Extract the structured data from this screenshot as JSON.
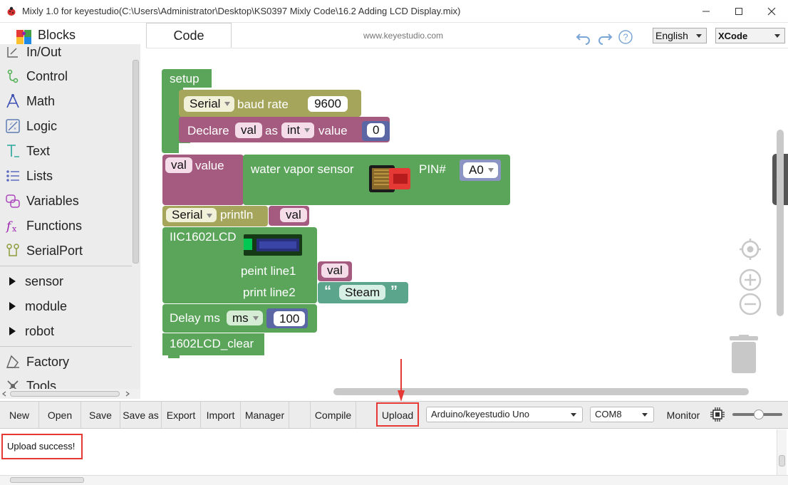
{
  "window": {
    "title": "Mixly 1.0 for keyestudio(C:\\Users\\Administrator\\Desktop\\KS0397 Mixly Code\\16.2 Adding LCD Display.mix)",
    "min_icon": "minimize-icon",
    "max_icon": "maximize-icon",
    "close_icon": "close-icon"
  },
  "tabs": {
    "blocks": "Blocks",
    "code": "Code"
  },
  "header": {
    "site": "www.keyestudio.com",
    "language": "English",
    "code_mode": "XCode"
  },
  "toolbox": {
    "items": [
      {
        "label": "In/Out",
        "icon": "in-out-icon"
      },
      {
        "label": "Control",
        "icon": "control-icon"
      },
      {
        "label": "Math",
        "icon": "math-icon"
      },
      {
        "label": "Logic",
        "icon": "logic-icon"
      },
      {
        "label": "Text",
        "icon": "text-icon"
      },
      {
        "label": "Lists",
        "icon": "lists-icon"
      },
      {
        "label": "Variables",
        "icon": "variables-icon"
      },
      {
        "label": "Functions",
        "icon": "functions-icon"
      },
      {
        "label": "SerialPort",
        "icon": "serialport-icon"
      }
    ],
    "groups": [
      "sensor",
      "module",
      "robot"
    ],
    "extra": [
      {
        "label": "Factory",
        "icon": "factory-icon"
      },
      {
        "label": "Tools",
        "icon": "tools-icon"
      }
    ]
  },
  "blocks": {
    "setup": "setup",
    "serial": "Serial",
    "baud_rate": "baud rate",
    "baud_value": "9600",
    "declare": "Declare",
    "var_name": "val",
    "as": "as",
    "type": "int",
    "value_kw": "value",
    "init_value": "0",
    "assign_var": "val",
    "assign_value_kw": "value",
    "sensor_label": "water vapor sensor",
    "pin_label": "PIN#",
    "pin_value": "A0",
    "println_serial": "Serial",
    "println": "println",
    "println_var": "val",
    "lcd_label": "IIC1602LCD",
    "line1_label": "peint line1",
    "line1_var": "val",
    "line2_label": "print line2",
    "line2_text": "Steam",
    "delay_label": "Delay ms",
    "delay_unit": "ms",
    "delay_value": "100",
    "lcd_clear": "1602LCD_clear"
  },
  "toolbar": {
    "new": "New",
    "open": "Open",
    "save": "Save",
    "save_as": "Save as",
    "export": "Export",
    "import": "Import",
    "manager": "Manager",
    "compile": "Compile",
    "upload": "Upload",
    "board": "Arduino/keyestudio Uno",
    "port": "COM8",
    "monitor": "Monitor"
  },
  "console": {
    "message": "Upload success!"
  },
  "colors": {
    "setup_green": "#5ba55b",
    "serial_olive": "#a5a55b",
    "variable_pink": "#a55b80",
    "text_teal": "#5ba58c",
    "math_blue": "#5b67a5",
    "highlight_red": "#e53935"
  }
}
